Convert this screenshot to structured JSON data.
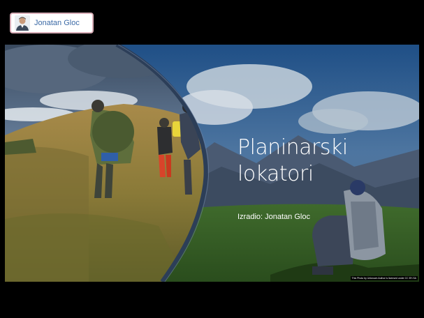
{
  "presenter": {
    "name": "Jonatan Gloc",
    "avatar_icon": "person-avatar-icon"
  },
  "slide": {
    "title_line1": "Planinarski",
    "title_line2": "lokatori",
    "subtitle": "Izradio: Jonatan Gloc",
    "photo_credit": "This Photo by Unknown Author is licensed under CC BY-SA"
  },
  "colors": {
    "background": "#000000",
    "arc": "#2c3e58",
    "presenter_name": "#3c6aa6",
    "presenter_border": "#d9aeb8"
  }
}
